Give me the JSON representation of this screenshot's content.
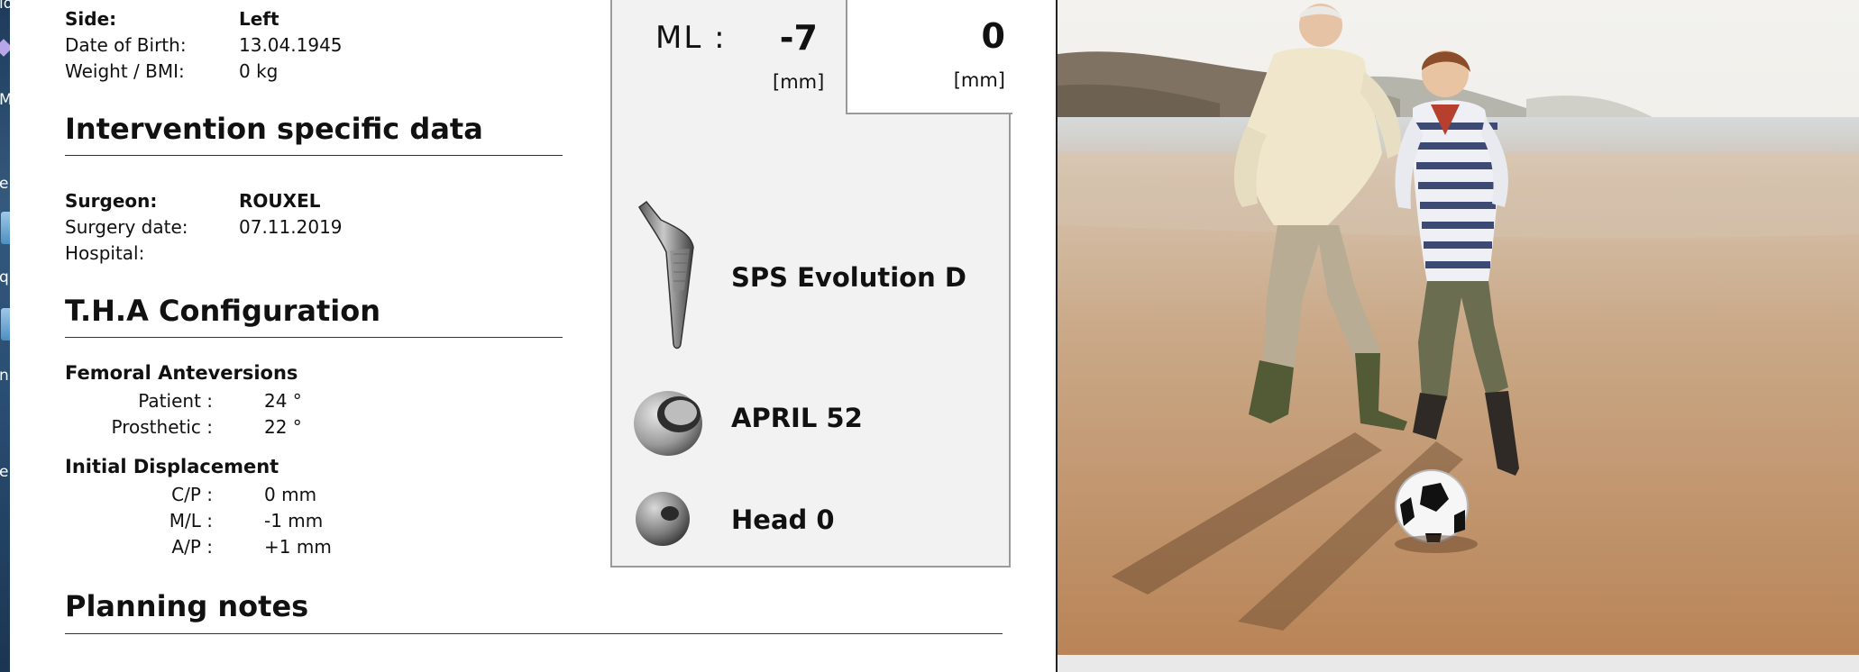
{
  "desktop": {
    "labels": [
      "ld",
      "M",
      "e",
      "q",
      "n",
      "e"
    ]
  },
  "patient": {
    "side_label": "Side:",
    "side_value": "Left",
    "dob_label": "Date of Birth:",
    "dob_value": "13.04.1945",
    "weight_label": "Weight / BMI:",
    "weight_value": "0 kg"
  },
  "intervention": {
    "title": "Intervention specific data",
    "surgeon_label": "Surgeon:",
    "surgeon_value": "ROUXEL",
    "surgery_date_label": "Surgery date:",
    "surgery_date_value": "07.11.2019",
    "hospital_label": "Hospital:",
    "hospital_value": ""
  },
  "tha": {
    "title": "T.H.A Configuration",
    "anteversions_title": "Femoral Anteversions",
    "patient_label": "Patient :",
    "patient_value": "24 °",
    "prosthetic_label": "Prosthetic :",
    "prosthetic_value": "22 °",
    "displacement_title": "Initial Displacement",
    "cp_label": "C/P :",
    "cp_value": "0 mm",
    "ml_label": "M/L :",
    "ml_value": "-1 mm",
    "ap_label": "A/P :",
    "ap_value": "+1 mm"
  },
  "planning": {
    "title": "Planning notes"
  },
  "measure_panel": {
    "ml_label": "ML :",
    "ml_value": "-7",
    "ml_unit": "[mm]",
    "right_value": "0",
    "right_unit": "[mm]",
    "components": [
      {
        "name": "SPS Evolution D",
        "icon": "femoral-stem-icon"
      },
      {
        "name": "APRIL 52",
        "icon": "acetabular-cup-icon"
      },
      {
        "name": "Head 0",
        "icon": "femoral-head-icon"
      }
    ]
  },
  "photo": {
    "subject": "grandfather and boy playing football on beach"
  },
  "colors": {
    "panel_bg": "#f2f2f2",
    "panel_border": "#9a9a9a",
    "sand": "#c49a6e",
    "sea": "#cfd6d8"
  }
}
